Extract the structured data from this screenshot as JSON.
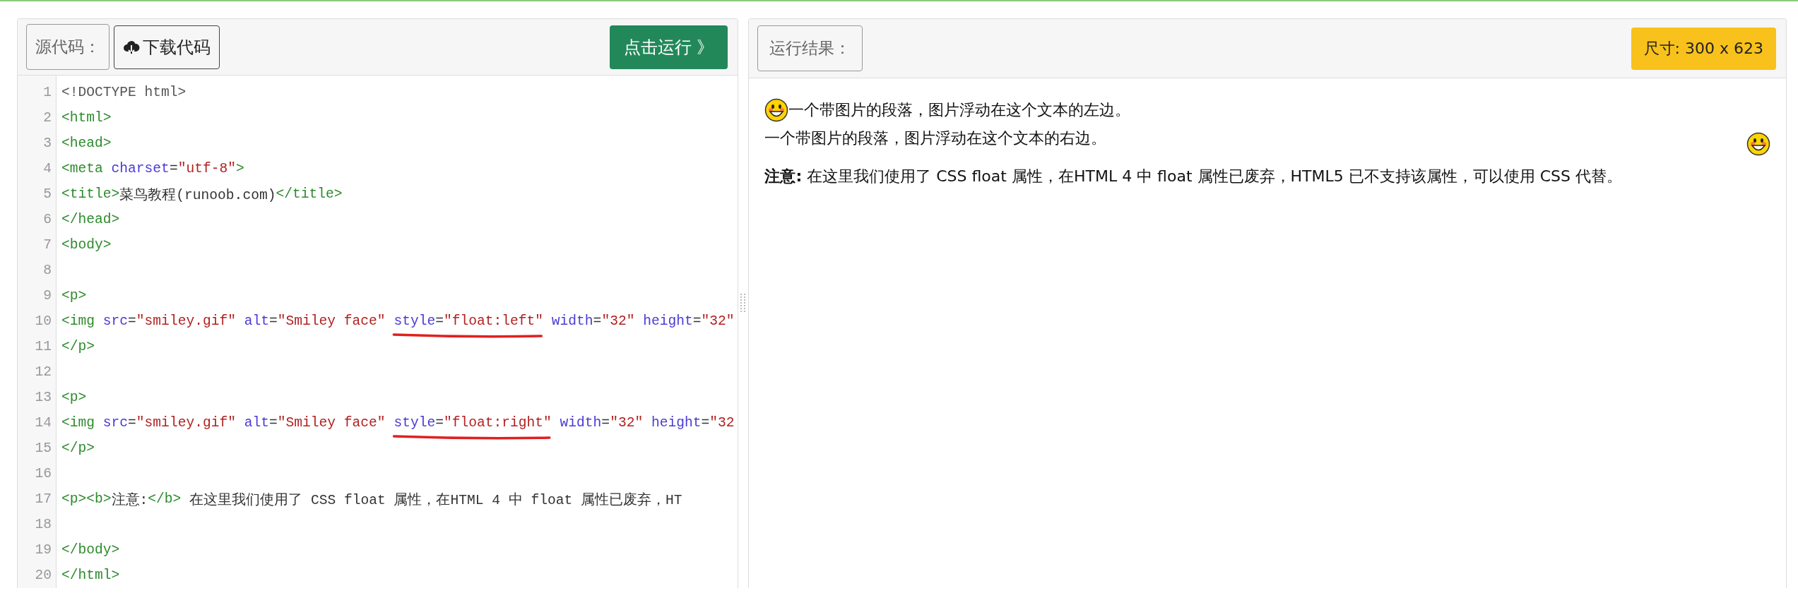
{
  "editor": {
    "source_label": "源代码：",
    "download_button": "下载代码",
    "run_button": "点击运行 》",
    "lines": [
      {
        "number": "1",
        "segments": [
          {
            "kind": "doctype",
            "text": "<!DOCTYPE html>"
          }
        ]
      },
      {
        "number": "2",
        "segments": [
          {
            "kind": "tag",
            "text": "<html>"
          }
        ]
      },
      {
        "number": "3",
        "segments": [
          {
            "kind": "tag",
            "text": "<head>"
          }
        ]
      },
      {
        "number": "4",
        "segments": [
          {
            "kind": "tag",
            "text": "<meta "
          },
          {
            "kind": "attr",
            "text": "charset"
          },
          {
            "kind": "text",
            "text": "="
          },
          {
            "kind": "string",
            "text": "\"utf-8\""
          },
          {
            "kind": "tag",
            "text": ">"
          }
        ]
      },
      {
        "number": "5",
        "segments": [
          {
            "kind": "tag",
            "text": "<title>"
          },
          {
            "kind": "text",
            "text": "菜鸟教程(runoob.com)"
          },
          {
            "kind": "tag",
            "text": "</title>"
          }
        ]
      },
      {
        "number": "6",
        "segments": [
          {
            "kind": "tag",
            "text": "</head>"
          }
        ]
      },
      {
        "number": "7",
        "segments": [
          {
            "kind": "tag",
            "text": "<body>"
          }
        ]
      },
      {
        "number": "8"
      },
      {
        "number": "9",
        "segments": [
          {
            "kind": "tag",
            "text": "<p>"
          }
        ]
      },
      {
        "number": "10",
        "segments": [
          {
            "kind": "tag",
            "text": "<img "
          },
          {
            "kind": "attr",
            "text": "src"
          },
          {
            "kind": "text",
            "text": "="
          },
          {
            "kind": "string",
            "text": "\"smiley.gif\" "
          },
          {
            "kind": "attr",
            "text": "alt"
          },
          {
            "kind": "text",
            "text": "="
          },
          {
            "kind": "string",
            "text": "\"Smiley face\" "
          },
          {
            "kind": "attr",
            "text": "style",
            "marked": true
          },
          {
            "kind": "text",
            "text": "=",
            "marked": true
          },
          {
            "kind": "string",
            "text": "\"float:left\"",
            "marked": true
          },
          {
            "kind": "attr",
            "text": " width"
          },
          {
            "kind": "text",
            "text": "="
          },
          {
            "kind": "string",
            "text": "\"32\" "
          },
          {
            "kind": "attr",
            "text": "height"
          },
          {
            "kind": "text",
            "text": "="
          },
          {
            "kind": "string",
            "text": "\"32\""
          }
        ]
      },
      {
        "number": "11",
        "segments": [
          {
            "kind": "tag",
            "text": "</p>"
          }
        ]
      },
      {
        "number": "12"
      },
      {
        "number": "13",
        "segments": [
          {
            "kind": "tag",
            "text": "<p>"
          }
        ]
      },
      {
        "number": "14",
        "segments": [
          {
            "kind": "tag",
            "text": "<img "
          },
          {
            "kind": "attr",
            "text": "src"
          },
          {
            "kind": "text",
            "text": "="
          },
          {
            "kind": "string",
            "text": "\"smiley.gif\" "
          },
          {
            "kind": "attr",
            "text": "alt"
          },
          {
            "kind": "text",
            "text": "="
          },
          {
            "kind": "string",
            "text": "\"Smiley face\" "
          },
          {
            "kind": "attr",
            "text": "style",
            "marked": true
          },
          {
            "kind": "text",
            "text": "=",
            "marked": true
          },
          {
            "kind": "string",
            "text": "\"float:right\"",
            "marked": true
          },
          {
            "kind": "attr",
            "text": " width"
          },
          {
            "kind": "text",
            "text": "="
          },
          {
            "kind": "string",
            "text": "\"32\" "
          },
          {
            "kind": "attr",
            "text": "height"
          },
          {
            "kind": "text",
            "text": "="
          },
          {
            "kind": "string",
            "text": "\"32"
          }
        ]
      },
      {
        "number": "15",
        "segments": [
          {
            "kind": "tag",
            "text": "</p>"
          }
        ]
      },
      {
        "number": "16"
      },
      {
        "number": "17",
        "segments": [
          {
            "kind": "tag",
            "text": "<p><b>"
          },
          {
            "kind": "text",
            "text": "注意:"
          },
          {
            "kind": "tag",
            "text": "</b>"
          },
          {
            "kind": "text",
            "text": " 在这里我们使用了 CSS float 属性，在HTML 4 中 float 属性已废弃，HT"
          }
        ]
      },
      {
        "number": "18"
      },
      {
        "number": "19",
        "segments": [
          {
            "kind": "tag",
            "text": "</body>"
          }
        ]
      },
      {
        "number": "20",
        "segments": [
          {
            "kind": "tag",
            "text": "</html>"
          }
        ]
      }
    ]
  },
  "result": {
    "label": "运行结果：",
    "size_badge": "尺寸: 300 x 623",
    "paragraphs": [
      {
        "kind": "float_left",
        "text": "一个带图片的段落，图片浮动在这个文本的左边。"
      },
      {
        "kind": "float_right",
        "text": "一个带图片的段落，图片浮动在这个文本的右边。"
      },
      {
        "kind": "plain",
        "text": "**注意:** 在这里我们使用了 CSS float 属性，在HTML 4 中 float 属性已废弃，HTML5 已不支持该属性，可以使用 CSS 代替。"
      }
    ]
  }
}
